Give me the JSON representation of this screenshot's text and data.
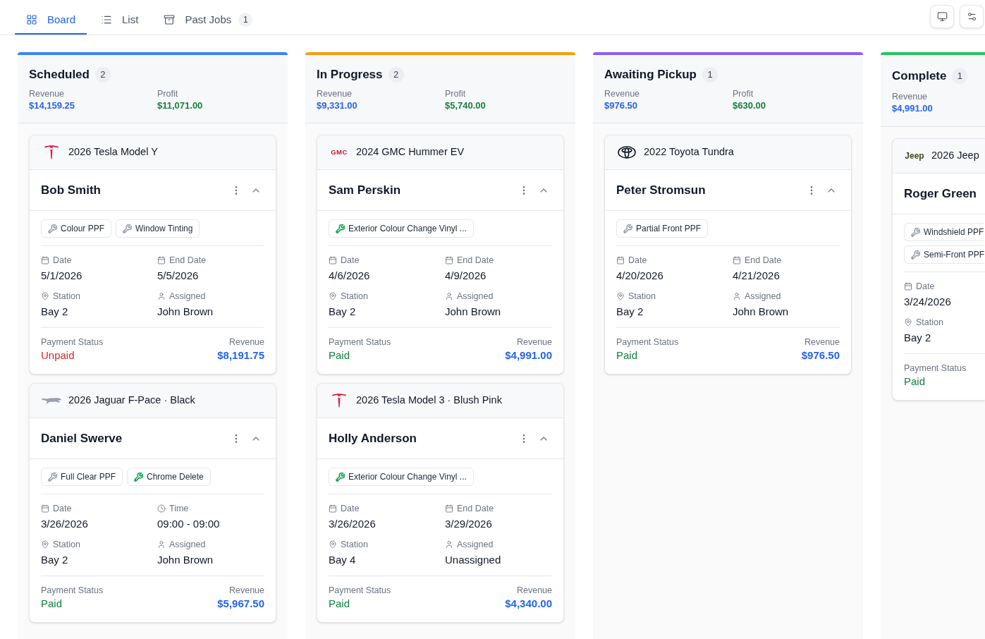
{
  "tabs": [
    {
      "kind": "grid",
      "label": "Board",
      "selected": true
    },
    {
      "kind": "list",
      "label": "List",
      "selected": false
    },
    {
      "kind": "archive",
      "label": "Past Jobs",
      "selected": false,
      "count": "1"
    }
  ],
  "columns": [
    {
      "title": "Scheduled",
      "count": "2",
      "color": "#3b82f6",
      "stats": [
        {
          "kind": "revenue",
          "label": "Revenue",
          "value": "$14,159.25"
        },
        {
          "kind": "profit",
          "label": "Profit",
          "value": "$11,071.00"
        }
      ],
      "cards": [
        {
          "vehicle": {
            "kind": "tesla",
            "name": "2026 Tesla Model Y"
          },
          "customer": "Bob Smith",
          "services": [
            {
              "label": "Colour PPF",
              "color": "#9ca3af"
            },
            {
              "label": "Window Tinting",
              "color": "#9ca3af"
            }
          ],
          "fields": [
            {
              "kind": "date",
              "label": "Date",
              "value": "5/1/2026"
            },
            {
              "kind": "date",
              "label": "End Date",
              "value": "5/5/2026"
            },
            {
              "kind": "station",
              "label": "Station",
              "value": "Bay 2"
            },
            {
              "kind": "person",
              "label": "Assigned",
              "value": "John Brown"
            }
          ],
          "payment": {
            "label": "Payment Status",
            "value": "Unpaid",
            "paid": false
          },
          "revenue": {
            "label": "Revenue",
            "value": "$8,191.75"
          }
        },
        {
          "vehicle": {
            "kind": "jaguar",
            "name": "2026 Jaguar F-Pace · Black"
          },
          "customer": "Daniel Swerve",
          "services": [
            {
              "label": "Full Clear PPF",
              "color": "#9ca3af"
            },
            {
              "label": "Chrome Delete",
              "color": "#16a34a"
            }
          ],
          "fields": [
            {
              "kind": "date",
              "label": "Date",
              "value": "3/26/2026"
            },
            {
              "kind": "time",
              "label": "Time",
              "value": "09:00 - 09:00"
            },
            {
              "kind": "station",
              "label": "Station",
              "value": "Bay 2"
            },
            {
              "kind": "person",
              "label": "Assigned",
              "value": "John Brown"
            }
          ],
          "payment": {
            "label": "Payment Status",
            "value": "Paid",
            "paid": true
          },
          "revenue": {
            "label": "Revenue",
            "value": "$5,967.50"
          }
        }
      ]
    },
    {
      "title": "In Progress",
      "count": "2",
      "color": "#f59e0b",
      "stats": [
        {
          "kind": "revenue",
          "label": "Revenue",
          "value": "$9,331.00"
        },
        {
          "kind": "profit",
          "label": "Profit",
          "value": "$5,740.00"
        }
      ],
      "cards": [
        {
          "vehicle": {
            "kind": "gmc",
            "logo_text": "GMC",
            "name": "2024 GMC Hummer EV"
          },
          "customer": "Sam Perskin",
          "services": [
            {
              "label": "Exterior Colour Change Vinyl ...",
              "color": "#16a34a"
            }
          ],
          "fields": [
            {
              "kind": "date",
              "label": "Date",
              "value": "4/6/2026"
            },
            {
              "kind": "date",
              "label": "End Date",
              "value": "4/9/2026"
            },
            {
              "kind": "station",
              "label": "Station",
              "value": "Bay 2"
            },
            {
              "kind": "person",
              "label": "Assigned",
              "value": "John Brown"
            }
          ],
          "payment": {
            "label": "Payment Status",
            "value": "Paid",
            "paid": true
          },
          "revenue": {
            "label": "Revenue",
            "value": "$4,991.00"
          }
        },
        {
          "vehicle": {
            "kind": "tesla",
            "name": "2026 Tesla Model 3 · Blush Pink"
          },
          "customer": "Holly Anderson",
          "services": [
            {
              "label": "Exterior Colour Change Vinyl ...",
              "color": "#16a34a"
            }
          ],
          "fields": [
            {
              "kind": "date",
              "label": "Date",
              "value": "3/26/2026"
            },
            {
              "kind": "date",
              "label": "End Date",
              "value": "3/29/2026"
            },
            {
              "kind": "station",
              "label": "Station",
              "value": "Bay 4"
            },
            {
              "kind": "person",
              "label": "Assigned",
              "value": "Unassigned"
            }
          ],
          "payment": {
            "label": "Payment Status",
            "value": "Paid",
            "paid": true
          },
          "revenue": {
            "label": "Revenue",
            "value": "$4,340.00"
          }
        }
      ]
    },
    {
      "title": "Awaiting Pickup",
      "count": "1",
      "color": "#8b5cf6",
      "stats": [
        {
          "kind": "revenue",
          "label": "Revenue",
          "value": "$976.50"
        },
        {
          "kind": "profit",
          "label": "Profit",
          "value": "$630.00"
        }
      ],
      "cards": [
        {
          "vehicle": {
            "kind": "toyota",
            "name": "2022 Toyota Tundra"
          },
          "customer": "Peter Stromsun",
          "services": [
            {
              "label": "Partial Front PPF",
              "color": "#9ca3af"
            }
          ],
          "fields": [
            {
              "kind": "date",
              "label": "Date",
              "value": "4/20/2026"
            },
            {
              "kind": "date",
              "label": "End Date",
              "value": "4/21/2026"
            },
            {
              "kind": "station",
              "label": "Station",
              "value": "Bay 2"
            },
            {
              "kind": "person",
              "label": "Assigned",
              "value": "John Brown"
            }
          ],
          "payment": {
            "label": "Payment Status",
            "value": "Paid",
            "paid": true
          },
          "revenue": {
            "label": "Revenue",
            "value": "$976.50"
          }
        }
      ]
    },
    {
      "title": "Complete",
      "count": "1",
      "color": "#22c55e",
      "stats": [
        {
          "kind": "revenue",
          "label": "Revenue",
          "value": "$4,991.00"
        }
      ],
      "cards": [
        {
          "vehicle": {
            "kind": "jeep",
            "logo_text": "Jeep",
            "name": "2026 Jeep"
          },
          "customer": "Roger Green",
          "services": [
            {
              "label": "Windshield PPF",
              "color": "#9ca3af"
            },
            {
              "label": "Semi-Front PPF",
              "color": "#9ca3af"
            }
          ],
          "fields": [
            {
              "kind": "date",
              "label": "Date",
              "value": "3/24/2026"
            },
            {
              "kind": "station",
              "label": "Station",
              "value": "Bay 2"
            }
          ],
          "payment": {
            "label": "Payment Status",
            "value": "Paid",
            "paid": true
          }
        }
      ]
    }
  ]
}
